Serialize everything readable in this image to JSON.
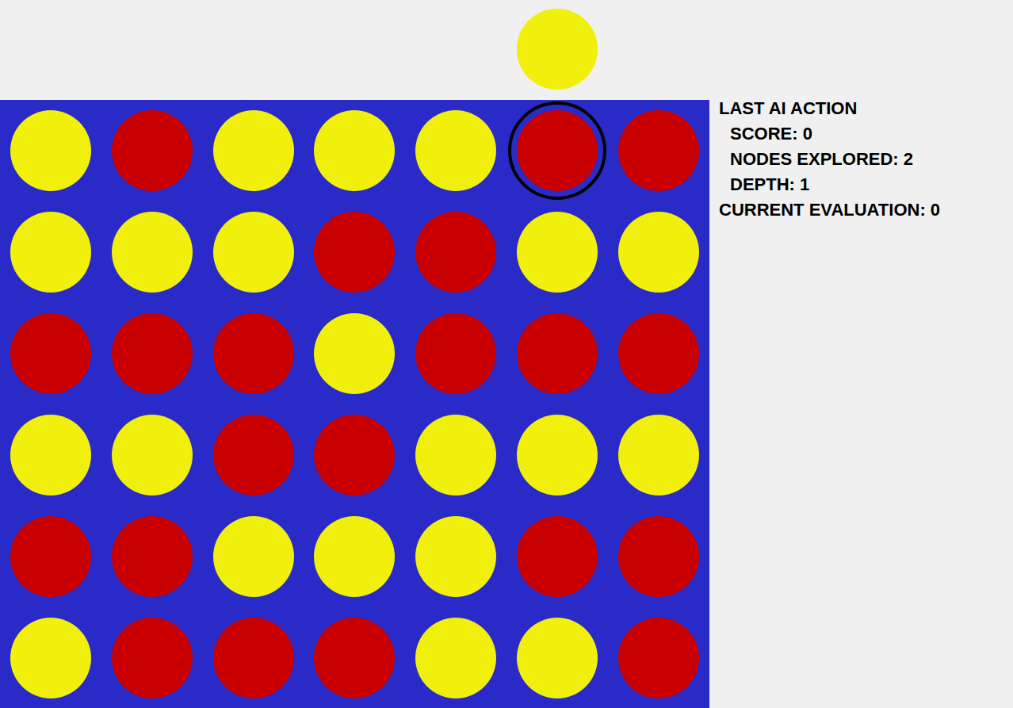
{
  "hover_piece": {
    "color": "#f0f00c",
    "column": 5
  },
  "board": {
    "rows": [
      [
        {
          "color": "#f0f00c",
          "highlighted": false
        },
        {
          "color": "#c80000",
          "highlighted": false
        },
        {
          "color": "#f0f00c",
          "highlighted": false
        },
        {
          "color": "#f0f00c",
          "highlighted": false
        },
        {
          "color": "#f0f00c",
          "highlighted": false
        },
        {
          "color": "#c80000",
          "highlighted": true
        },
        {
          "color": "#c80000",
          "highlighted": false
        }
      ],
      [
        {
          "color": "#f0f00c",
          "highlighted": false
        },
        {
          "color": "#f0f00c",
          "highlighted": false
        },
        {
          "color": "#f0f00c",
          "highlighted": false
        },
        {
          "color": "#c80000",
          "highlighted": false
        },
        {
          "color": "#c80000",
          "highlighted": false
        },
        {
          "color": "#f0f00c",
          "highlighted": false
        },
        {
          "color": "#f0f00c",
          "highlighted": false
        }
      ],
      [
        {
          "color": "#c80000",
          "highlighted": false
        },
        {
          "color": "#c80000",
          "highlighted": false
        },
        {
          "color": "#c80000",
          "highlighted": false
        },
        {
          "color": "#f0f00c",
          "highlighted": false
        },
        {
          "color": "#c80000",
          "highlighted": false
        },
        {
          "color": "#c80000",
          "highlighted": false
        },
        {
          "color": "#c80000",
          "highlighted": false
        }
      ],
      [
        {
          "color": "#f0f00c",
          "highlighted": false
        },
        {
          "color": "#f0f00c",
          "highlighted": false
        },
        {
          "color": "#c80000",
          "highlighted": false
        },
        {
          "color": "#c80000",
          "highlighted": false
        },
        {
          "color": "#f0f00c",
          "highlighted": false
        },
        {
          "color": "#f0f00c",
          "highlighted": false
        },
        {
          "color": "#f0f00c",
          "highlighted": false
        }
      ],
      [
        {
          "color": "#c80000",
          "highlighted": false
        },
        {
          "color": "#c80000",
          "highlighted": false
        },
        {
          "color": "#f0f00c",
          "highlighted": false
        },
        {
          "color": "#f0f00c",
          "highlighted": false
        },
        {
          "color": "#f0f00c",
          "highlighted": false
        },
        {
          "color": "#c80000",
          "highlighted": false
        },
        {
          "color": "#c80000",
          "highlighted": false
        }
      ],
      [
        {
          "color": "#f0f00c",
          "highlighted": false
        },
        {
          "color": "#c80000",
          "highlighted": false
        },
        {
          "color": "#c80000",
          "highlighted": false
        },
        {
          "color": "#c80000",
          "highlighted": false
        },
        {
          "color": "#f0f00c",
          "highlighted": false
        },
        {
          "color": "#f0f00c",
          "highlighted": false
        },
        {
          "color": "#c80000",
          "highlighted": false
        }
      ]
    ]
  },
  "info": {
    "title": "LAST AI ACTION",
    "items": [
      "SCORE: 0",
      "NODES EXPLORED: 2",
      "DEPTH: 1"
    ],
    "evaluation": "CURRENT EVALUATION: 0"
  }
}
